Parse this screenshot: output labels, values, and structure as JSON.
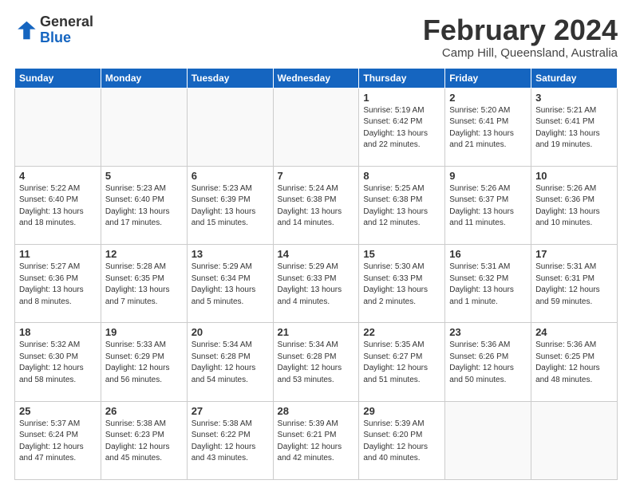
{
  "header": {
    "logo_general": "General",
    "logo_blue": "Blue",
    "month_title": "February 2024",
    "location": "Camp Hill, Queensland, Australia"
  },
  "days_of_week": [
    "Sunday",
    "Monday",
    "Tuesday",
    "Wednesday",
    "Thursday",
    "Friday",
    "Saturday"
  ],
  "weeks": [
    [
      {
        "day": "",
        "info": ""
      },
      {
        "day": "",
        "info": ""
      },
      {
        "day": "",
        "info": ""
      },
      {
        "day": "",
        "info": ""
      },
      {
        "day": "1",
        "info": "Sunrise: 5:19 AM\nSunset: 6:42 PM\nDaylight: 13 hours\nand 22 minutes."
      },
      {
        "day": "2",
        "info": "Sunrise: 5:20 AM\nSunset: 6:41 PM\nDaylight: 13 hours\nand 21 minutes."
      },
      {
        "day": "3",
        "info": "Sunrise: 5:21 AM\nSunset: 6:41 PM\nDaylight: 13 hours\nand 19 minutes."
      }
    ],
    [
      {
        "day": "4",
        "info": "Sunrise: 5:22 AM\nSunset: 6:40 PM\nDaylight: 13 hours\nand 18 minutes."
      },
      {
        "day": "5",
        "info": "Sunrise: 5:23 AM\nSunset: 6:40 PM\nDaylight: 13 hours\nand 17 minutes."
      },
      {
        "day": "6",
        "info": "Sunrise: 5:23 AM\nSunset: 6:39 PM\nDaylight: 13 hours\nand 15 minutes."
      },
      {
        "day": "7",
        "info": "Sunrise: 5:24 AM\nSunset: 6:38 PM\nDaylight: 13 hours\nand 14 minutes."
      },
      {
        "day": "8",
        "info": "Sunrise: 5:25 AM\nSunset: 6:38 PM\nDaylight: 13 hours\nand 12 minutes."
      },
      {
        "day": "9",
        "info": "Sunrise: 5:26 AM\nSunset: 6:37 PM\nDaylight: 13 hours\nand 11 minutes."
      },
      {
        "day": "10",
        "info": "Sunrise: 5:26 AM\nSunset: 6:36 PM\nDaylight: 13 hours\nand 10 minutes."
      }
    ],
    [
      {
        "day": "11",
        "info": "Sunrise: 5:27 AM\nSunset: 6:36 PM\nDaylight: 13 hours\nand 8 minutes."
      },
      {
        "day": "12",
        "info": "Sunrise: 5:28 AM\nSunset: 6:35 PM\nDaylight: 13 hours\nand 7 minutes."
      },
      {
        "day": "13",
        "info": "Sunrise: 5:29 AM\nSunset: 6:34 PM\nDaylight: 13 hours\nand 5 minutes."
      },
      {
        "day": "14",
        "info": "Sunrise: 5:29 AM\nSunset: 6:33 PM\nDaylight: 13 hours\nand 4 minutes."
      },
      {
        "day": "15",
        "info": "Sunrise: 5:30 AM\nSunset: 6:33 PM\nDaylight: 13 hours\nand 2 minutes."
      },
      {
        "day": "16",
        "info": "Sunrise: 5:31 AM\nSunset: 6:32 PM\nDaylight: 13 hours\nand 1 minute."
      },
      {
        "day": "17",
        "info": "Sunrise: 5:31 AM\nSunset: 6:31 PM\nDaylight: 12 hours\nand 59 minutes."
      }
    ],
    [
      {
        "day": "18",
        "info": "Sunrise: 5:32 AM\nSunset: 6:30 PM\nDaylight: 12 hours\nand 58 minutes."
      },
      {
        "day": "19",
        "info": "Sunrise: 5:33 AM\nSunset: 6:29 PM\nDaylight: 12 hours\nand 56 minutes."
      },
      {
        "day": "20",
        "info": "Sunrise: 5:34 AM\nSunset: 6:28 PM\nDaylight: 12 hours\nand 54 minutes."
      },
      {
        "day": "21",
        "info": "Sunrise: 5:34 AM\nSunset: 6:28 PM\nDaylight: 12 hours\nand 53 minutes."
      },
      {
        "day": "22",
        "info": "Sunrise: 5:35 AM\nSunset: 6:27 PM\nDaylight: 12 hours\nand 51 minutes."
      },
      {
        "day": "23",
        "info": "Sunrise: 5:36 AM\nSunset: 6:26 PM\nDaylight: 12 hours\nand 50 minutes."
      },
      {
        "day": "24",
        "info": "Sunrise: 5:36 AM\nSunset: 6:25 PM\nDaylight: 12 hours\nand 48 minutes."
      }
    ],
    [
      {
        "day": "25",
        "info": "Sunrise: 5:37 AM\nSunset: 6:24 PM\nDaylight: 12 hours\nand 47 minutes."
      },
      {
        "day": "26",
        "info": "Sunrise: 5:38 AM\nSunset: 6:23 PM\nDaylight: 12 hours\nand 45 minutes."
      },
      {
        "day": "27",
        "info": "Sunrise: 5:38 AM\nSunset: 6:22 PM\nDaylight: 12 hours\nand 43 minutes."
      },
      {
        "day": "28",
        "info": "Sunrise: 5:39 AM\nSunset: 6:21 PM\nDaylight: 12 hours\nand 42 minutes."
      },
      {
        "day": "29",
        "info": "Sunrise: 5:39 AM\nSunset: 6:20 PM\nDaylight: 12 hours\nand 40 minutes."
      },
      {
        "day": "",
        "info": ""
      },
      {
        "day": "",
        "info": ""
      }
    ]
  ]
}
